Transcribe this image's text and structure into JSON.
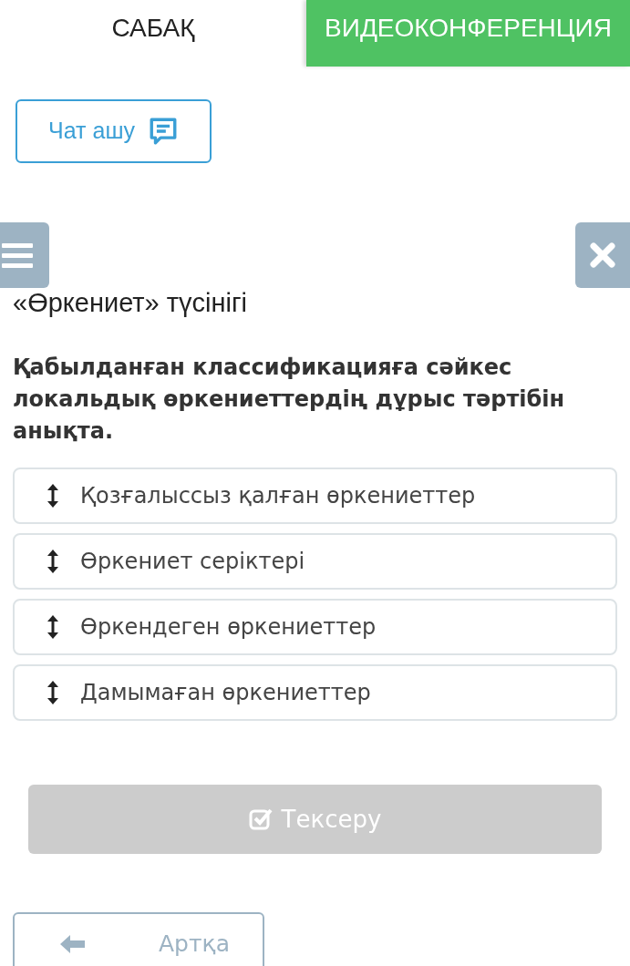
{
  "tabs": [
    {
      "label": "САБАҚ",
      "selected": true
    },
    {
      "label": "ВИДЕОКОНФЕРЕНЦИЯ",
      "selected": false
    }
  ],
  "chat_button": {
    "label": "Чат ашу"
  },
  "title": "«Өркениет» түсінігі",
  "question": "Қабылданған классификацияға сәйкес локальдық өркениеттердің дұрыс тәртібін анықта.",
  "items": [
    {
      "label": "Қозғалыссыз қалған өркениеттер"
    },
    {
      "label": "Өркениет серіктері"
    },
    {
      "label": "Өркендеген өркениеттер"
    },
    {
      "label": "Дамымаған өркениеттер"
    }
  ],
  "check_button": {
    "label": "Тексеру",
    "disabled": true
  },
  "back_button": {
    "label": "Артқа"
  }
}
